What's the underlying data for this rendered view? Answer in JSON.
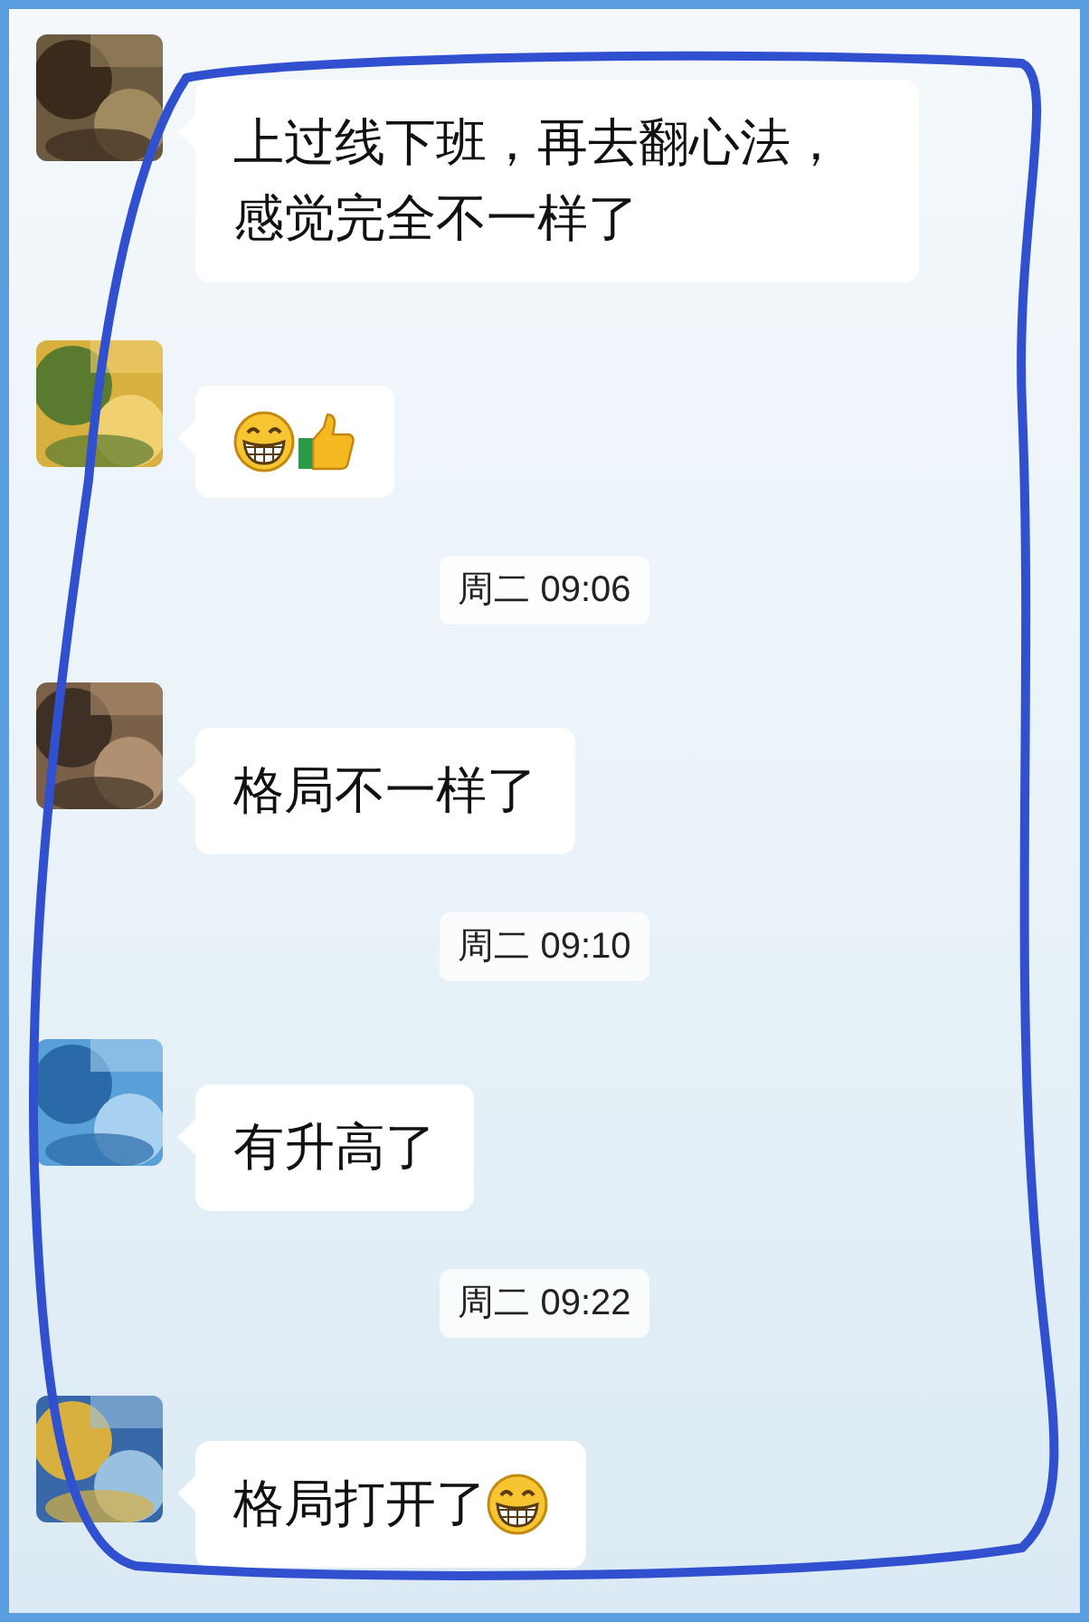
{
  "items": [
    {
      "kind": "message",
      "parts": [
        {
          "kind": "text",
          "text": "上过线下班，再去翻心法，感觉完全不一样了"
        }
      ]
    },
    {
      "kind": "message",
      "parts": [
        {
          "kind": "grin"
        },
        {
          "kind": "thumbs"
        }
      ]
    },
    {
      "kind": "time",
      "text": "周二 09:06"
    },
    {
      "kind": "message",
      "parts": [
        {
          "kind": "text",
          "text": "格局不一样了"
        }
      ]
    },
    {
      "kind": "time",
      "text": "周二 09:10"
    },
    {
      "kind": "message",
      "parts": [
        {
          "kind": "text",
          "text": "有升高了"
        }
      ]
    },
    {
      "kind": "time",
      "text": "周二 09:22"
    },
    {
      "kind": "message",
      "parts": [
        {
          "kind": "text",
          "text": "格局打开了"
        },
        {
          "kind": "grin"
        }
      ]
    }
  ]
}
